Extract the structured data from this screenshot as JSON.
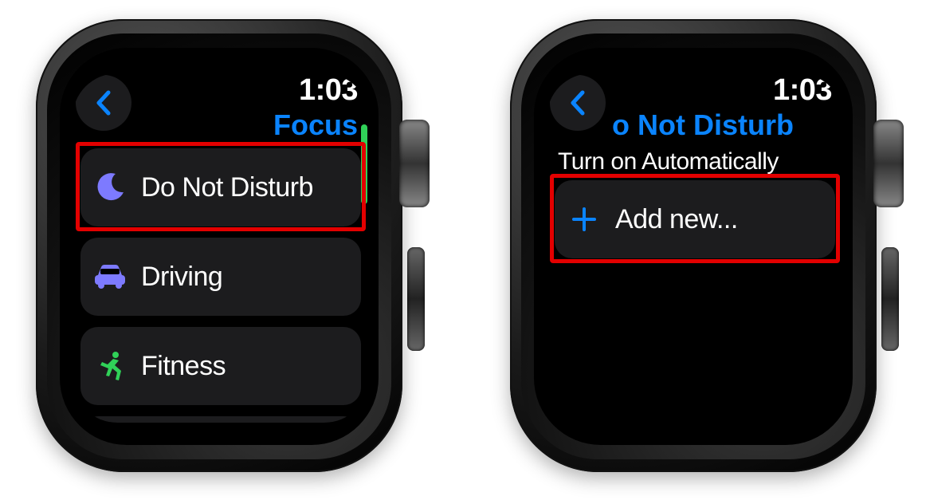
{
  "left": {
    "time": "1:03",
    "title": "Focus",
    "rows": [
      {
        "icon": "moon-icon",
        "label": "Do Not Disturb",
        "color": "#7d7aff",
        "highlight": true
      },
      {
        "icon": "car-icon",
        "label": "Driving",
        "color": "#7d7aff",
        "highlight": false
      },
      {
        "icon": "runner-icon",
        "label": "Fitness",
        "color": "#30d158",
        "highlight": false
      }
    ]
  },
  "right": {
    "time": "1:03",
    "title": "o Not Disturb",
    "section_header": "Turn on Automatically",
    "add_row": {
      "icon": "plus-icon",
      "label": "Add new...",
      "color": "#0a84ff",
      "highlight": true
    }
  }
}
